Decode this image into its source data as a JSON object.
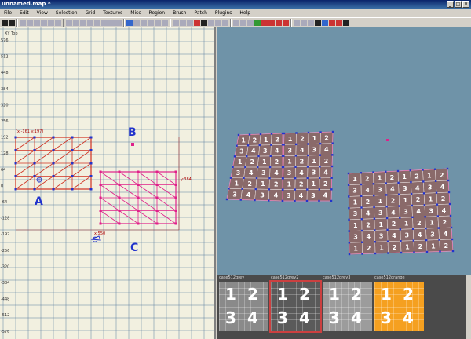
{
  "window": {
    "title": "unnamed.map *",
    "min": "_",
    "max": "□",
    "close": "×"
  },
  "menu": [
    "File",
    "Edit",
    "View",
    "Selection",
    "Grid",
    "Textures",
    "Misc",
    "Region",
    "Brush",
    "Patch",
    "Plugins",
    "Help"
  ],
  "view2d": {
    "title": "XY Top",
    "y_ticks": [
      "576",
      "512",
      "448",
      "384",
      "320",
      "256",
      "192",
      "128",
      "64",
      "0",
      "-64",
      "-128",
      "-192",
      "-256",
      "-320",
      "-384",
      "-448",
      "-512",
      "-576"
    ],
    "coords": "(x:-161 y:197)",
    "dim_y": "y:384",
    "dim_x": "x:550",
    "labels": {
      "a": "A",
      "b": "B",
      "c": "C"
    }
  },
  "textures": [
    {
      "name": "case512grey",
      "n": [
        "1",
        "2",
        "3",
        "4"
      ],
      "bg": "#8a8a8a"
    },
    {
      "name": "case512grey2",
      "n": [
        "1",
        "2",
        "3",
        "4"
      ],
      "bg": "#5a5a5a"
    },
    {
      "name": "case512grey3",
      "n": [
        "1",
        "2",
        "3",
        "4"
      ],
      "bg": "#9c9c9c"
    },
    {
      "name": "case512orange",
      "n": [
        "1",
        "2",
        "3",
        "4"
      ],
      "bg": "#f5a020"
    }
  ],
  "colors": {
    "grid_bg": "#f2f0e0",
    "grid_line": "#5a7ea0",
    "patch_red": "#d03020",
    "patch_pink": "#e0208a",
    "handle_blue": "#2233cc",
    "view3d_bg": "#6f93a8"
  }
}
